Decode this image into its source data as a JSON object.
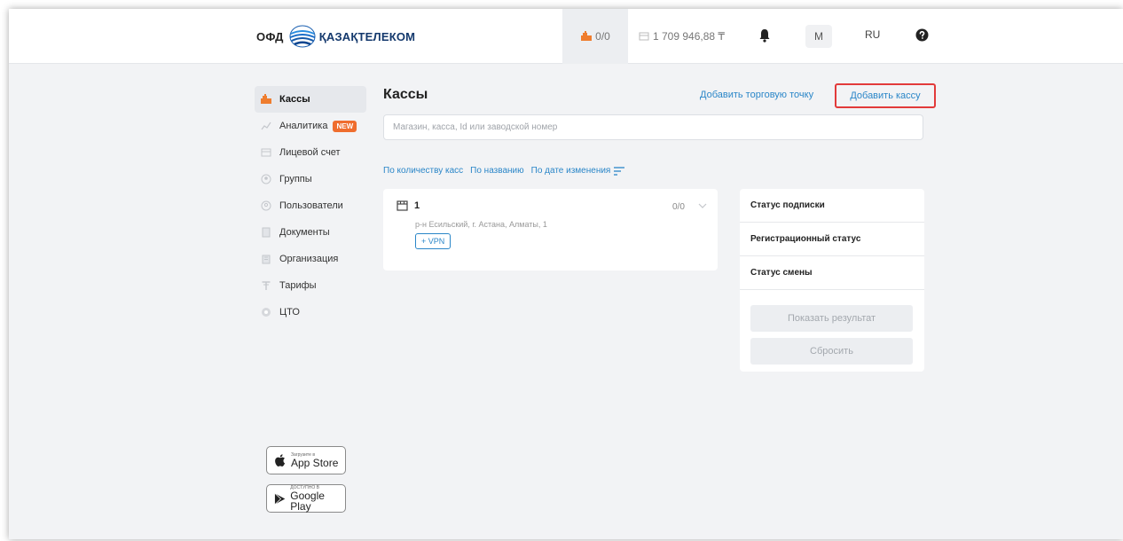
{
  "header": {
    "logo_ofd": "ОФД",
    "logo_name": "ҚАЗАҚТЕЛЕКОМ",
    "kkm_count": "0/0",
    "balance": "1 709 946,88 ₸",
    "avatar_initial": "M",
    "language": "RU"
  },
  "sidebar": {
    "items": [
      {
        "label": "Кассы",
        "icon": "cash-register-icon"
      },
      {
        "label": "Аналитика",
        "icon": "chart-icon",
        "badge": "NEW"
      },
      {
        "label": "Лицевой счет",
        "icon": "wallet-icon"
      },
      {
        "label": "Группы",
        "icon": "groups-icon"
      },
      {
        "label": "Пользователи",
        "icon": "users-icon"
      },
      {
        "label": "Документы",
        "icon": "document-icon"
      },
      {
        "label": "Организация",
        "icon": "building-icon"
      },
      {
        "label": "Тарифы",
        "icon": "tariff-icon"
      },
      {
        "label": "ЦТО",
        "icon": "service-icon"
      }
    ],
    "app_store": {
      "small": "Загрузите в",
      "big": "App Store"
    },
    "google_play": {
      "small": "ДОСТУПНО В",
      "big": "Google Play"
    }
  },
  "main": {
    "title": "Кассы",
    "add_point": "Добавить торговую точку",
    "add_kassa": "Добавить кассу",
    "search_placeholder": "Магазин, касса, Id или заводской номер",
    "sort": {
      "by_count": "По количеству касс",
      "by_name": "По названию",
      "by_date": "По дате изменения"
    },
    "kassa": {
      "name": "1",
      "count": "0/0",
      "address": "р-н Есильский, г. Астана, Алматы, 1",
      "vpn": "+ VPN"
    }
  },
  "filter": {
    "subscription": "Статус подписки",
    "registration": "Регистрационный статус",
    "shift": "Статус смены",
    "show": "Показать результат",
    "reset": "Сбросить"
  },
  "colors": {
    "accent": "#2a86c8",
    "highlight": "#e23a3a",
    "new_badge": "#ef6d2e"
  }
}
